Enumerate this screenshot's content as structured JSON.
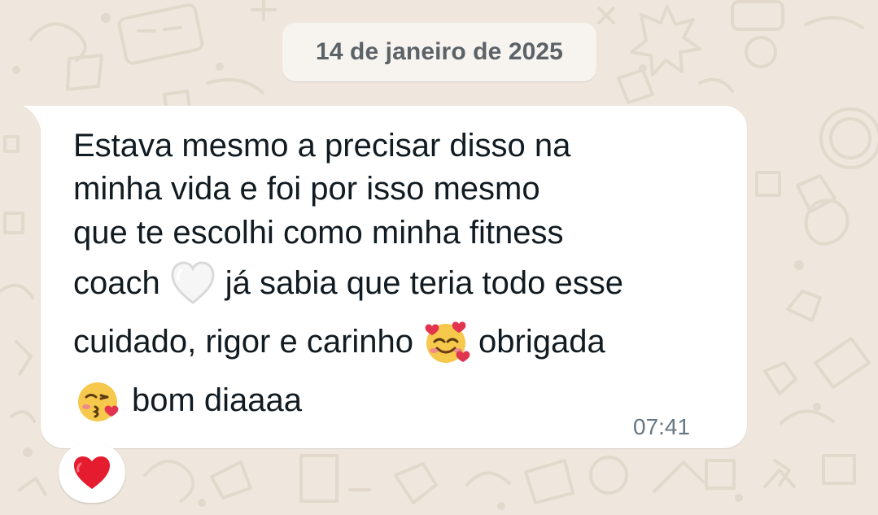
{
  "date_chip": "14 de janeiro de 2025",
  "message": {
    "lines": [
      "Estava mesmo a precisar disso na",
      "minha vida e foi por isso mesmo",
      "que te escolhi como minha fitness",
      "coach",
      "já sabia que teria todo esse",
      "cuidado, rigor e carinho",
      "obrigada",
      "bom diaaaa"
    ],
    "time": "07:41"
  },
  "reaction": {
    "emoji": "red-heart"
  },
  "emojis": [
    "white-heart-emoji",
    "smiling-face-with-hearts-emoji",
    "face-blowing-a-kiss-emoji"
  ],
  "colors": {
    "background": "#efe7dd",
    "bubble": "#ffffff",
    "date_chip": "#f7f4ef",
    "text": "#111b21",
    "meta_text": "#667781"
  }
}
